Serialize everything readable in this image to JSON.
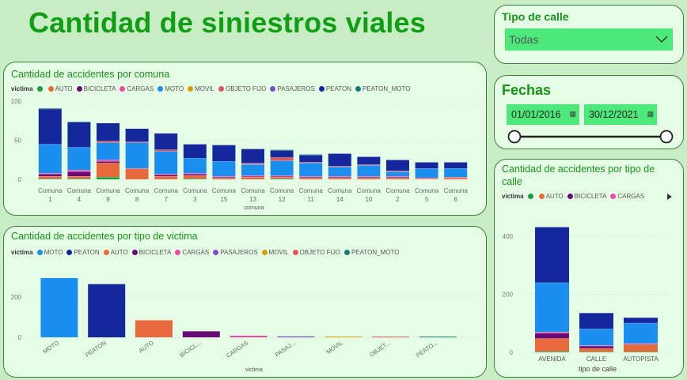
{
  "page": {
    "title": "Cantidad de siniestros viales"
  },
  "colors": {
    "AUTO": "#e8693b",
    "BICICLETA": "#6a0a77",
    "CARGAS": "#ec4ba6",
    "MOTO": "#1b8ff0",
    "MOVIL": "#d9a000",
    "OBJETO FIJO": "#e2555a",
    "PASAJEROS": "#7a4fc8",
    "PEATON": "#14289b",
    "PEATON_MOTO": "#1a7a7a",
    "green": "#1e9e3e"
  },
  "tipo_calle_slicer": {
    "label": "Tipo de calle",
    "value": "Todas",
    "icon": "chevron-down-icon"
  },
  "fechas_slicer": {
    "label": "Fechas",
    "start": "01/01/2016",
    "end": "30/12/2021",
    "icon": "calendar-icon",
    "range_start_fraction": 0,
    "range_end_fraction": 1
  },
  "comuna_chart": {
    "title": "Cantidad de accidentes por comuna",
    "legend_title": "victima",
    "legend": [
      {
        "name": "",
        "color": "#1e9e3e"
      },
      {
        "name": "AUTO",
        "color": "#e8693b"
      },
      {
        "name": "BICICLETA",
        "color": "#6a0a77"
      },
      {
        "name": "CARGAS",
        "color": "#ec4ba6"
      },
      {
        "name": "MOTO",
        "color": "#1b8ff0"
      },
      {
        "name": "MOVIL",
        "color": "#d9a000"
      },
      {
        "name": "OBJETO FIJO",
        "color": "#e2555a"
      },
      {
        "name": "PASAJEROS",
        "color": "#7a4fc8"
      },
      {
        "name": "PEATON",
        "color": "#14289b"
      },
      {
        "name": "PEATON_MOTO",
        "color": "#1a7a7a"
      }
    ],
    "xlabel": "comuna",
    "yticks": [
      "0",
      "50",
      "100"
    ]
  },
  "victima_chart": {
    "title": "Cantidad de accidentes por tipo de victima",
    "legend_title": "victima",
    "legend": [
      {
        "name": "MOTO",
        "color": "#1b8ff0"
      },
      {
        "name": "PEATON",
        "color": "#14289b"
      },
      {
        "name": "AUTO",
        "color": "#e8693b"
      },
      {
        "name": "BICICLETA",
        "color": "#6a0a77"
      },
      {
        "name": "CARGAS",
        "color": "#ec4ba6"
      },
      {
        "name": "PASAJEROS",
        "color": "#7a4fc8"
      },
      {
        "name": "MOVIL",
        "color": "#d9a000"
      },
      {
        "name": "OBJETO FIJO",
        "color": "#e2555a"
      },
      {
        "name": "PEATON_MOTO",
        "color": "#1a7a7a"
      }
    ],
    "xlabel": "victima",
    "yticks": [
      "0",
      "200"
    ]
  },
  "calle_chart": {
    "title_line1": "Cantidad de accidentes por tipo de",
    "title_line2": "calle",
    "legend_title": "victima",
    "legend": [
      {
        "name": "",
        "color": "#1e9e3e"
      },
      {
        "name": "AUTO",
        "color": "#e8693b"
      },
      {
        "name": "BICICLETA",
        "color": "#6a0a77"
      },
      {
        "name": "CARGAS",
        "color": "#ec4ba6"
      }
    ],
    "legend_more_icon": "triangle-right-icon",
    "xlabel": "tipo de calle",
    "yticks": [
      "0",
      "200",
      "400"
    ]
  },
  "chart_data": [
    {
      "type": "bar",
      "stacked": true,
      "title": "Cantidad de accidentes por comuna",
      "xlabel": "comuna",
      "ylabel": "",
      "ylim": [
        0,
        100
      ],
      "categories": [
        "Comuna 1",
        "Comuna 4",
        "Comuna 9",
        "Comuna 8",
        "Comuna 7",
        "Comuna 3",
        "Comuna 15",
        "Comuna 13",
        "Comuna 12",
        "Comuna 11",
        "Comuna 14",
        "Comuna 10",
        "Comuna 2",
        "Comuna 5",
        "Comuna 6"
      ],
      "category_lines": [
        [
          "Comuna",
          "1"
        ],
        [
          "Comuna",
          "4"
        ],
        [
          "Comuna",
          "9"
        ],
        [
          "Comuna",
          "8"
        ],
        [
          "Comuna",
          "7"
        ],
        [
          "Comuna",
          "3"
        ],
        [
          "Comuna",
          "15"
        ],
        [
          "Comuna",
          "13"
        ],
        [
          "Comuna",
          "12"
        ],
        [
          "Comuna",
          "11"
        ],
        [
          "Comuna",
          "14"
        ],
        [
          "Comuna",
          "10"
        ],
        [
          "Comuna",
          "2"
        ],
        [
          "Comuna",
          "5"
        ],
        [
          "Comuna",
          "6"
        ]
      ],
      "series": [
        {
          "name": "",
          "color": "#1e9e3e",
          "values": [
            1,
            1,
            3,
            0,
            0,
            1,
            0,
            0,
            1,
            0,
            0,
            0,
            0,
            0,
            0
          ]
        },
        {
          "name": "AUTO",
          "color": "#e8693b",
          "values": [
            3,
            3,
            18,
            14,
            4,
            4,
            2,
            3,
            2,
            2,
            2,
            2,
            2,
            1,
            2
          ]
        },
        {
          "name": "BICICLETA",
          "color": "#6a0a77",
          "values": [
            3,
            6,
            2,
            0,
            2,
            2,
            1,
            1,
            1,
            1,
            1,
            1,
            1,
            0,
            0
          ]
        },
        {
          "name": "CARGAS",
          "color": "#ec4ba6",
          "values": [
            1,
            2,
            2,
            0,
            1,
            1,
            1,
            1,
            1,
            1,
            1,
            1,
            1,
            1,
            1
          ]
        },
        {
          "name": "MOTO",
          "color": "#1b8ff0",
          "values": [
            37,
            29,
            22,
            33,
            29,
            19,
            19,
            14,
            19,
            17,
            12,
            14,
            6,
            12,
            11
          ]
        },
        {
          "name": "MOVIL",
          "color": "#d9a000",
          "values": [
            0,
            0,
            0,
            0,
            0,
            0,
            0,
            0,
            0,
            0,
            0,
            0,
            0,
            0,
            0
          ]
        },
        {
          "name": "OBJETO FIJO",
          "color": "#e2555a",
          "values": [
            0,
            0,
            2,
            1,
            2,
            0,
            0,
            1,
            4,
            1,
            1,
            1,
            1,
            0,
            0
          ]
        },
        {
          "name": "PASAJEROS",
          "color": "#7a4fc8",
          "values": [
            0,
            0,
            0,
            0,
            0,
            0,
            0,
            1,
            0,
            0,
            0,
            0,
            0,
            0,
            0
          ]
        },
        {
          "name": "PEATON",
          "color": "#14289b",
          "values": [
            45,
            32,
            23,
            17,
            21,
            18,
            21,
            18,
            9,
            9,
            16,
            10,
            14,
            8,
            8
          ]
        },
        {
          "name": "PEATON_MOTO",
          "color": "#1a7a7a",
          "values": [
            1,
            1,
            0,
            0,
            0,
            0,
            0,
            0,
            1,
            1,
            0,
            0,
            0,
            0,
            0
          ]
        }
      ]
    },
    {
      "type": "bar",
      "title": "Cantidad de accidentes por tipo de victima",
      "xlabel": "victima",
      "ylabel": "",
      "ylim": [
        0,
        350
      ],
      "categories": [
        "MOTO",
        "PEATON",
        "AUTO",
        "BICICL...",
        "CARGAS",
        "PASAJ...",
        "MOVIL",
        "OBJET...",
        "PEATO..."
      ],
      "values": [
        295,
        265,
        85,
        30,
        8,
        5,
        3,
        2,
        1
      ],
      "colors": [
        "#1b8ff0",
        "#14289b",
        "#e8693b",
        "#6a0a77",
        "#ec4ba6",
        "#7a4fc8",
        "#d9a000",
        "#e2555a",
        "#1a7a7a"
      ]
    },
    {
      "type": "bar",
      "stacked": true,
      "title": "Cantidad de accidentes por tipo de calle",
      "xlabel": "tipo de calle",
      "ylabel": "",
      "ylim": [
        0,
        430
      ],
      "categories": [
        "AVENIDA",
        "CALLE",
        "AUTOPISTA"
      ],
      "series": [
        {
          "name": "",
          "color": "#1e9e3e",
          "values": [
            3,
            2,
            2
          ]
        },
        {
          "name": "AUTO",
          "color": "#e8693b",
          "values": [
            45,
            12,
            25
          ]
        },
        {
          "name": "BICICLETA",
          "color": "#6a0a77",
          "values": [
            18,
            8,
            2
          ]
        },
        {
          "name": "CARGAS",
          "color": "#ec4ba6",
          "values": [
            4,
            2,
            2
          ]
        },
        {
          "name": "MOTO",
          "color": "#1b8ff0",
          "values": [
            170,
            57,
            70
          ]
        },
        {
          "name": "PEATON",
          "color": "#14289b",
          "values": [
            192,
            55,
            19
          ]
        }
      ]
    }
  ]
}
